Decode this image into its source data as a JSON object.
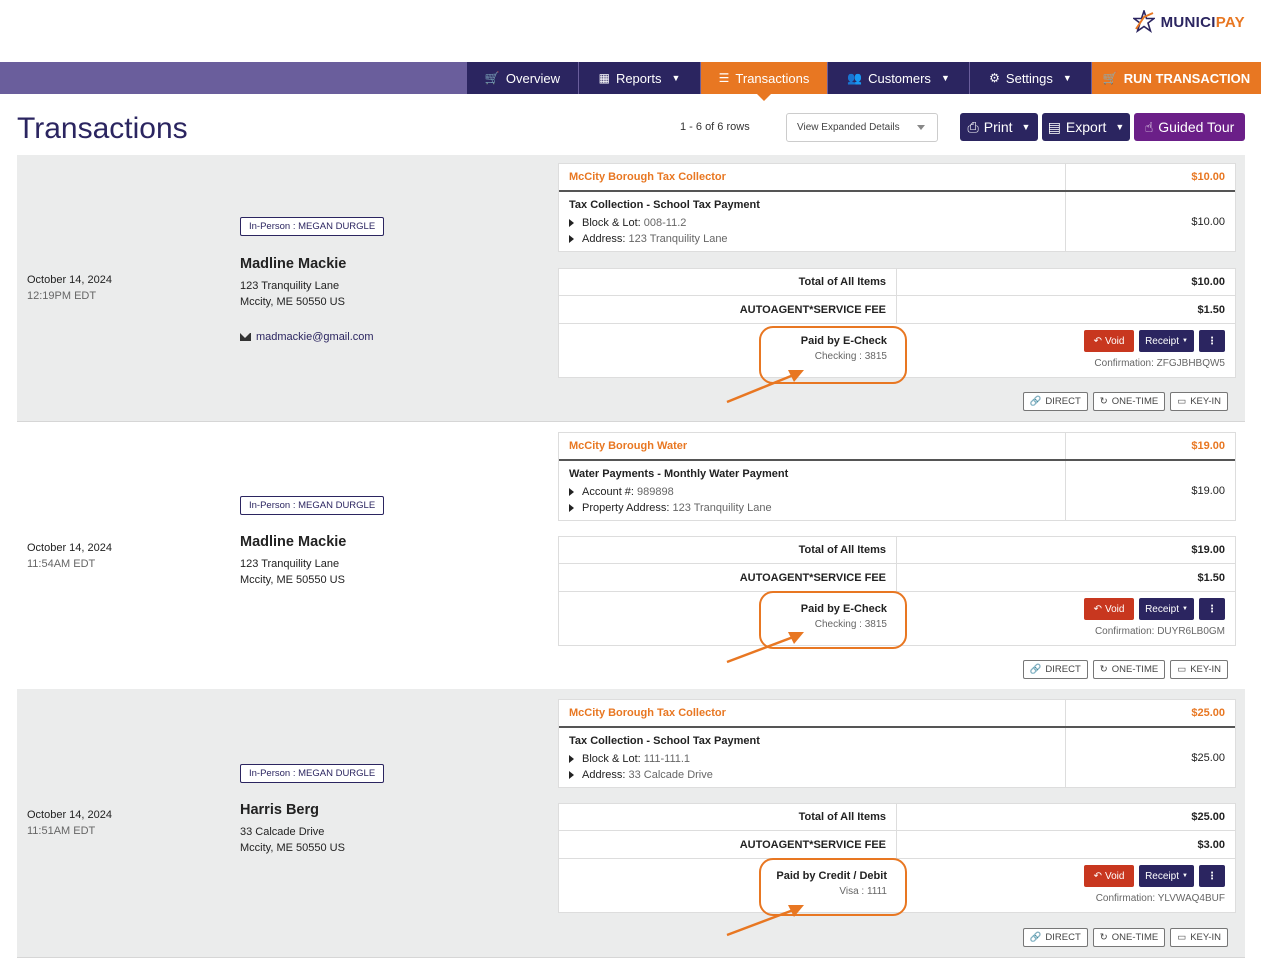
{
  "brand": {
    "name_main": "MUNICI",
    "name_accent": "PAY"
  },
  "nav": {
    "overview": "Overview",
    "reports": "Reports",
    "transactions": "Transactions",
    "customers": "Customers",
    "settings": "Settings",
    "run": "RUN TRANSACTION"
  },
  "page": {
    "title": "Transactions",
    "rows_info": "1 - 6 of 6 rows",
    "view_select": "View Expanded Details",
    "print": "Print",
    "export": "Export",
    "tour": "Guided Tour"
  },
  "colors": {
    "brand": "#2b2560",
    "accent": "#e87722",
    "void": "#c8371f",
    "tour": "#6b1f88"
  },
  "transactions": [
    {
      "date": "October 14, 2024",
      "time": "12:19PM EDT",
      "badge": "In-Person : MEGAN DURGLE",
      "name": "Madline Mackie",
      "addr1": "123 Tranquility Lane",
      "addr2": "Mccity, ME 50550 US",
      "email": "madmackie@gmail.com",
      "org": "McCity Borough Tax Collector",
      "org_amount": "$10.00",
      "item_title": "Tax Collection - School Tax Payment",
      "detail1_label": "Block & Lot:",
      "detail1_value": "008-11.2",
      "detail2_label": "Address:",
      "detail2_value": "123 Tranquility Lane",
      "item_amount": "$10.00",
      "total_label": "Total of All Items",
      "total": "$10.00",
      "fee_label": "AUTOAGENT*SERVICE FEE",
      "fee": "$1.50",
      "paid_by": "Paid by E-Check",
      "account": "Checking : 3815",
      "void": "Void",
      "receipt": "Receipt",
      "more": "⋮",
      "confirmation": "Confirmation: ZFGJBHBQW5",
      "tag_direct": "DIRECT",
      "tag_onetime": "ONE-TIME",
      "tag_keyin": "KEY-IN"
    },
    {
      "date": "October 14, 2024",
      "time": "11:54AM EDT",
      "badge": "In-Person : MEGAN DURGLE",
      "name": "Madline Mackie",
      "addr1": "123 Tranquility Lane",
      "addr2": "Mccity, ME 50550 US",
      "email": "",
      "org": "McCity Borough Water",
      "org_amount": "$19.00",
      "item_title": "Water Payments - Monthly Water Payment",
      "detail1_label": "Account #:",
      "detail1_value": "989898",
      "detail2_label": "Property Address:",
      "detail2_value": "123 Tranquility Lane",
      "item_amount": "$19.00",
      "total_label": "Total of All Items",
      "total": "$19.00",
      "fee_label": "AUTOAGENT*SERVICE FEE",
      "fee": "$1.50",
      "paid_by": "Paid by E-Check",
      "account": "Checking : 3815",
      "void": "Void",
      "receipt": "Receipt",
      "more": "⋮",
      "confirmation": "Confirmation: DUYR6LB0GM",
      "tag_direct": "DIRECT",
      "tag_onetime": "ONE-TIME",
      "tag_keyin": "KEY-IN"
    },
    {
      "date": "October 14, 2024",
      "time": "11:51AM EDT",
      "badge": "In-Person : MEGAN DURGLE",
      "name": "Harris Berg",
      "addr1": "33 Calcade Drive",
      "addr2": "Mccity, ME 50550 US",
      "email": "",
      "org": "McCity Borough Tax Collector",
      "org_amount": "$25.00",
      "item_title": "Tax Collection - School Tax Payment",
      "detail1_label": "Block & Lot:",
      "detail1_value": "111-111.1",
      "detail2_label": "Address:",
      "detail2_value": "33 Calcade Drive",
      "item_amount": "$25.00",
      "total_label": "Total of All Items",
      "total": "$25.00",
      "fee_label": "AUTOAGENT*SERVICE FEE",
      "fee": "$3.00",
      "paid_by": "Paid by Credit / Debit",
      "account": "Visa : 1111",
      "void": "Void",
      "receipt": "Receipt",
      "more": "⋮",
      "confirmation": "Confirmation: YLVWAQ4BUF",
      "tag_direct": "DIRECT",
      "tag_onetime": "ONE-TIME",
      "tag_keyin": "KEY-IN"
    }
  ]
}
